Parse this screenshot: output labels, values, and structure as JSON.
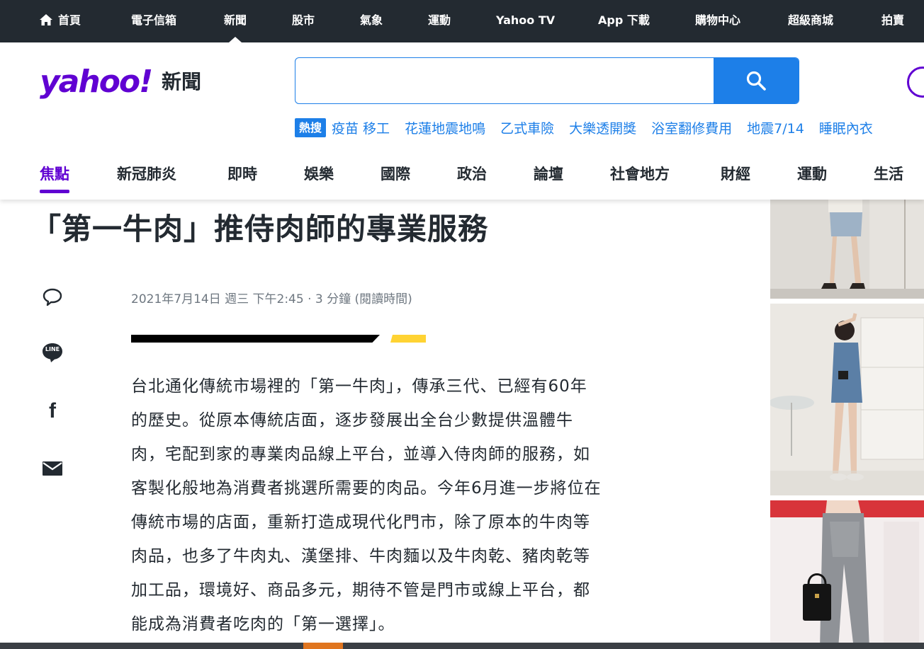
{
  "topnav": {
    "items": [
      {
        "label": "首頁"
      },
      {
        "label": "電子信箱"
      },
      {
        "label": "新聞"
      },
      {
        "label": "股市"
      },
      {
        "label": "氣象"
      },
      {
        "label": "運動"
      },
      {
        "label": "Yahoo TV"
      },
      {
        "label": "App 下載"
      },
      {
        "label": "購物中心"
      },
      {
        "label": "超級商城"
      },
      {
        "label": "拍賣"
      }
    ],
    "active": "新聞"
  },
  "logo": {
    "brand": "yahoo!",
    "section": "新聞"
  },
  "search": {
    "value": "",
    "placeholder": "",
    "button_icon": "search-icon"
  },
  "trending": {
    "badge": "熱搜",
    "links": [
      "疫苗 移工",
      "花蓮地震地鳴",
      "乙式車險",
      "大樂透開獎",
      "浴室翻修費用",
      "地震7/14",
      "睡眠內衣"
    ]
  },
  "categories": {
    "items": [
      "焦點",
      "新冠肺炎",
      "即時",
      "娛樂",
      "國際",
      "政治",
      "論壇",
      "社會地方",
      "財經",
      "運動",
      "生活"
    ],
    "active": "焦點"
  },
  "article": {
    "headline": "「第一牛肉」推侍肉師的專業服務",
    "meta": "2021年7月14日 週三 下午2:45 · 3 分鐘 (閱讀時間)",
    "body_lines": [
      "台北通化傳統市場裡的「第一牛肉」，傳承三代、已經有60年",
      "的歷史。從原本傳統店面，逐步發展出全台少數提供溫體牛",
      "肉，宅配到家的專業肉品線上平台，並導入侍肉師的服務，如",
      "客製化般地為消費者挑選所需要的肉品。今年6月進一步將位在",
      "傳統市場的店面，重新打造成現代化門市，除了原本的牛肉等",
      "肉品，也多了牛肉丸、漢堡排、牛肉麵以及牛肉乾、豬肉乾等",
      "加工品，環境好、商品多元，期待不管是門市或線上平台，都",
      "能成為消費者吃肉的「第一選擇」。"
    ]
  },
  "share": {
    "icons": [
      "comment-icon",
      "line-icon",
      "facebook-icon",
      "mail-icon"
    ],
    "line_text": "LINE",
    "facebook_text": "f"
  },
  "colors": {
    "brand_purple": "#6001d2",
    "link_blue": "#1d7fe8",
    "topbar": "#232a31",
    "accent_yellow": "#ffd333"
  }
}
